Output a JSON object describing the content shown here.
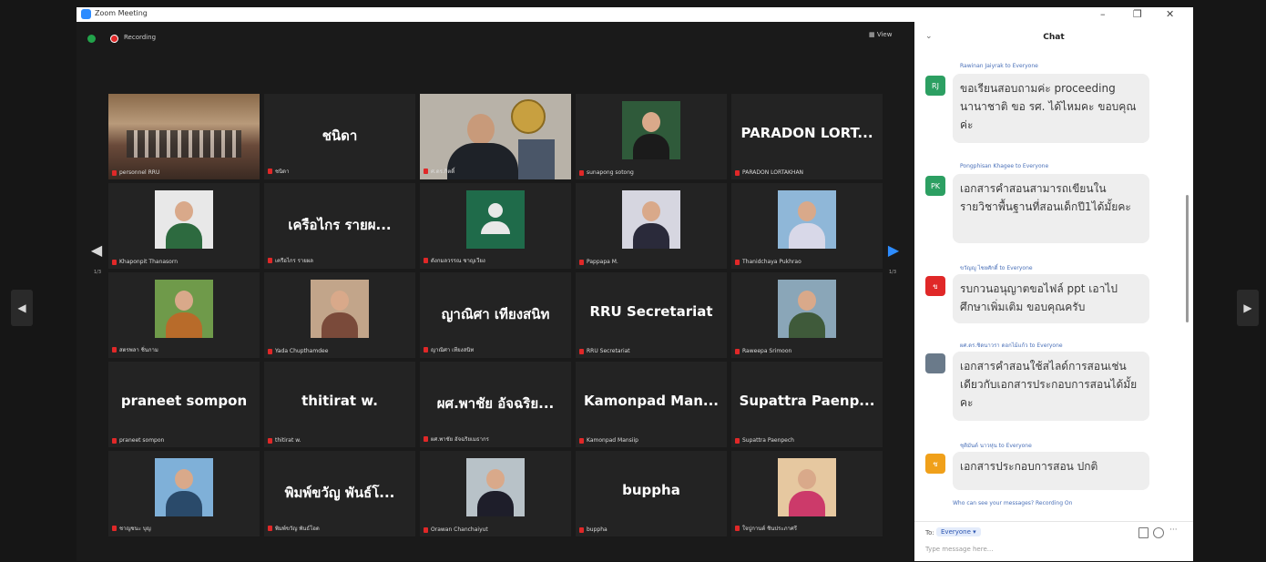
{
  "window": {
    "title": "Zoom Meeting",
    "controls": {
      "minimize": "–",
      "maximize": "❐",
      "close": "✕"
    }
  },
  "meeting": {
    "recording_label": "Recording",
    "view_label": "View",
    "left_page": "1/3",
    "right_page": "1/3",
    "tiles": [
      {
        "title": "",
        "name": "personnel RRU",
        "kind": "video-room",
        "active": true
      },
      {
        "title": "ชนิดา",
        "name": "ชนิดา",
        "kind": "name"
      },
      {
        "title": "",
        "name": "ศ.ดร.กิตติ์",
        "kind": "video-man"
      },
      {
        "title": "",
        "name": "sunapong sotong",
        "kind": "photo",
        "bg": "#2f5a3a",
        "shirt": "#1b1b1b"
      },
      {
        "title": "PARADON LORT...",
        "name": "PARADON LORTAKHAN",
        "kind": "name"
      },
      {
        "title": "",
        "name": "Khaponpit Thanasorn",
        "kind": "photo",
        "bg": "#e8e8e8",
        "shirt": "#2d6a3f"
      },
      {
        "title": "เครือไกร รายผ...",
        "name": "เครือไกร รายผล",
        "kind": "name"
      },
      {
        "title": "",
        "name": "ดังกมลวรรณ ชาญเวียง",
        "kind": "avatar-default"
      },
      {
        "title": "",
        "name": "Pappapa M.",
        "kind": "photo",
        "bg": "#d6d6e0",
        "shirt": "#2a2a3a"
      },
      {
        "title": "",
        "name": "Thanidchaya Pukhrao",
        "kind": "photo",
        "bg": "#8fb7d8",
        "shirt": "#d8d8e8"
      },
      {
        "title": "",
        "name": "สตรพลา ชิ่นกาม",
        "kind": "photo",
        "bg": "#6f9a4a",
        "shirt": "#b86b2a"
      },
      {
        "title": "",
        "name": "Yada Chupthamdee",
        "kind": "photo",
        "bg": "#c2a58a",
        "shirt": "#7a4a3a"
      },
      {
        "title": "ญาณิศา เทียงสนิท",
        "name": "ญาณิศา เทียงสนิท",
        "kind": "name"
      },
      {
        "title": "RRU Secretariat",
        "name": "RRU Secretariat",
        "kind": "name"
      },
      {
        "title": "",
        "name": "Raweepa Srimoon",
        "kind": "photo",
        "bg": "#8aa6b8",
        "shirt": "#3f5a3a"
      },
      {
        "title": "praneet sompon",
        "name": "praneet sompon",
        "kind": "name"
      },
      {
        "title": "thitirat  w.",
        "name": "thitirat w.",
        "kind": "name"
      },
      {
        "title": "ผศ.พาชัย อัจฉริย...",
        "name": "ผศ.พาชัย อัจฉริยเมธากร",
        "kind": "name"
      },
      {
        "title": "Kamonpad  Man...",
        "name": "Kamonpad Mansiip",
        "kind": "name"
      },
      {
        "title": "Supattra  Paenp...",
        "name": "Supattra Paenpech",
        "kind": "name"
      },
      {
        "title": "",
        "name": "ชาญชนะ บุญ",
        "kind": "photo",
        "bg": "#7fb0d8",
        "shirt": "#2a4a6a"
      },
      {
        "title": "พิมพ์ขวัญ พันธ์โ...",
        "name": "พิมพ์ขวัญ พันธ์โอด",
        "kind": "name"
      },
      {
        "title": "",
        "name": "Orawan Chanchaiyut",
        "kind": "photo",
        "bg": "#b8c2c8",
        "shirt": "#1e1e2a"
      },
      {
        "title": "buppha",
        "name": "buppha",
        "kind": "name"
      },
      {
        "title": "",
        "name": "ใจปูกานต์ ชินประภาศรี",
        "kind": "photo",
        "bg": "#e6c8a0",
        "shirt": "#cc3a6a"
      }
    ]
  },
  "chat": {
    "title": "Chat",
    "messages": [
      {
        "sender": "Rawinan Jaiyrak to Everyone",
        "avatar": "RJ",
        "color": "#2c9f62",
        "text": "ขอเรียนสอบถามค่ะ proceeding นานาชาติ ขอ รศ. ได้ไหมคะ ขอบคุณค่ะ"
      },
      {
        "sender": "Pongphisan Khagee to Everyone",
        "avatar": "PK",
        "color": "#2c9f62",
        "text": "เอกสารคำสอนสามารถเขียนในรายวิชาพื้นฐานที่สอนเด็กปี1ได้มั้ยคะ"
      },
      {
        "sender": "ขวัญญู ไชยศักดิ์ to Everyone",
        "avatar": "ข",
        "color": "#e02828",
        "text": "รบกวนอนุญาตขอไฟล์ ppt เอาไปศึกษาเพิ่มเติม ขอบคุณครับ"
      },
      {
        "sender": "ผศ.ดร.ชิดนาวรา ดอกไม้แก้ว to Everyone",
        "avatar": "",
        "color": "#6a7a8a",
        "text": "เอกสารคำสอนใช้สไลด์การสอนเช่นเดียวกับเอกสารประกอบการสอนได้มั้ยคะ"
      },
      {
        "sender": "ชุติมันต์ นาวหุ่น to Everyone",
        "avatar": "ช",
        "color": "#f0a01a",
        "text": "เอกสารประกอบการสอน ปกติ"
      }
    ],
    "privacy_note": "Who can see your messages? Recording On",
    "to_label": "To:",
    "recipient": "Everyone ▾",
    "input_placeholder": "Type message here..."
  },
  "colors": {
    "accent": "#2d8cff",
    "active_outline": "#f0e64a",
    "record": "#e02828"
  }
}
